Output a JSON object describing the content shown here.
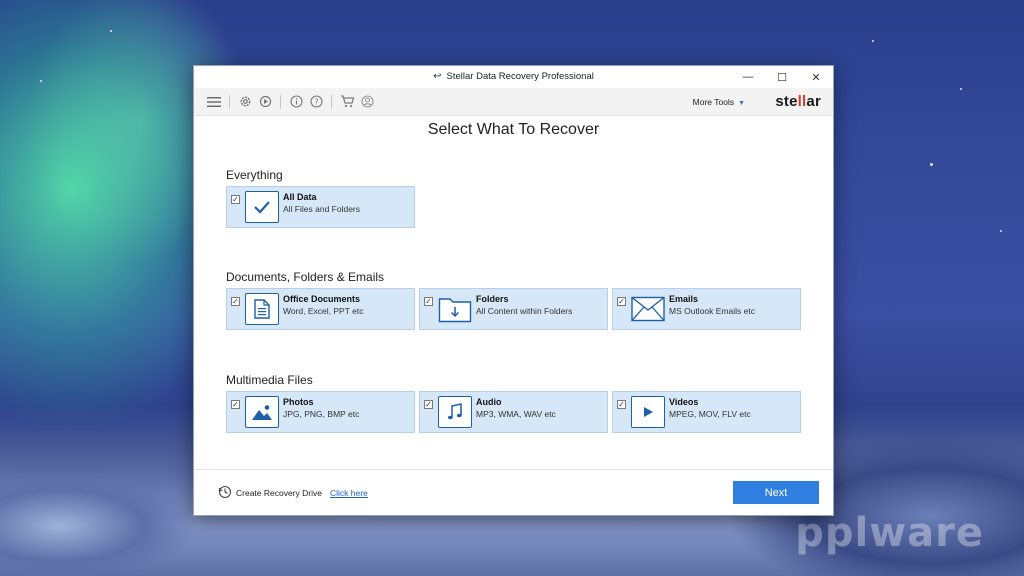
{
  "window": {
    "title": "Stellar Data Recovery Professional",
    "controls": {
      "minimize": "—",
      "maximize": "☐",
      "close": "✕"
    }
  },
  "toolbar": {
    "more_tools": "More Tools",
    "brand_pre": "ste",
    "brand_mid": "ll",
    "brand_post": "ar"
  },
  "main": {
    "heading": "Select What To Recover",
    "sections": [
      {
        "title": "Everything"
      },
      {
        "title": "Documents, Folders & Emails"
      },
      {
        "title": "Multimedia Files"
      }
    ],
    "cards": {
      "all_data": {
        "title": "All Data",
        "subtitle": "All Files and Folders",
        "icon": "checkmark-icon",
        "checked": true
      },
      "office_documents": {
        "title": "Office Documents",
        "subtitle": "Word, Excel, PPT etc",
        "icon": "document-icon",
        "checked": true
      },
      "folders": {
        "title": "Folders",
        "subtitle": "All Content within Folders",
        "icon": "folder-icon",
        "checked": true
      },
      "emails": {
        "title": "Emails",
        "subtitle": "MS Outlook Emails etc",
        "icon": "envelope-icon",
        "checked": true
      },
      "photos": {
        "title": "Photos",
        "subtitle": "JPG, PNG, BMP etc",
        "icon": "image-icon",
        "checked": true
      },
      "audio": {
        "title": "Audio",
        "subtitle": "MP3, WMA, WAV etc",
        "icon": "music-note-icon",
        "checked": true
      },
      "videos": {
        "title": "Videos",
        "subtitle": "MPEG, MOV, FLV etc",
        "icon": "play-icon",
        "checked": true
      }
    }
  },
  "footer": {
    "recovery_label": "Create Recovery Drive",
    "click_here": "Click here",
    "next_label": "Next"
  },
  "watermark": "pplware",
  "colors": {
    "accent": "#2f7fe0",
    "card_bg": "#d6e7f8",
    "icon_blue": "#1e5fa8",
    "brand_red": "#d43b2a"
  }
}
